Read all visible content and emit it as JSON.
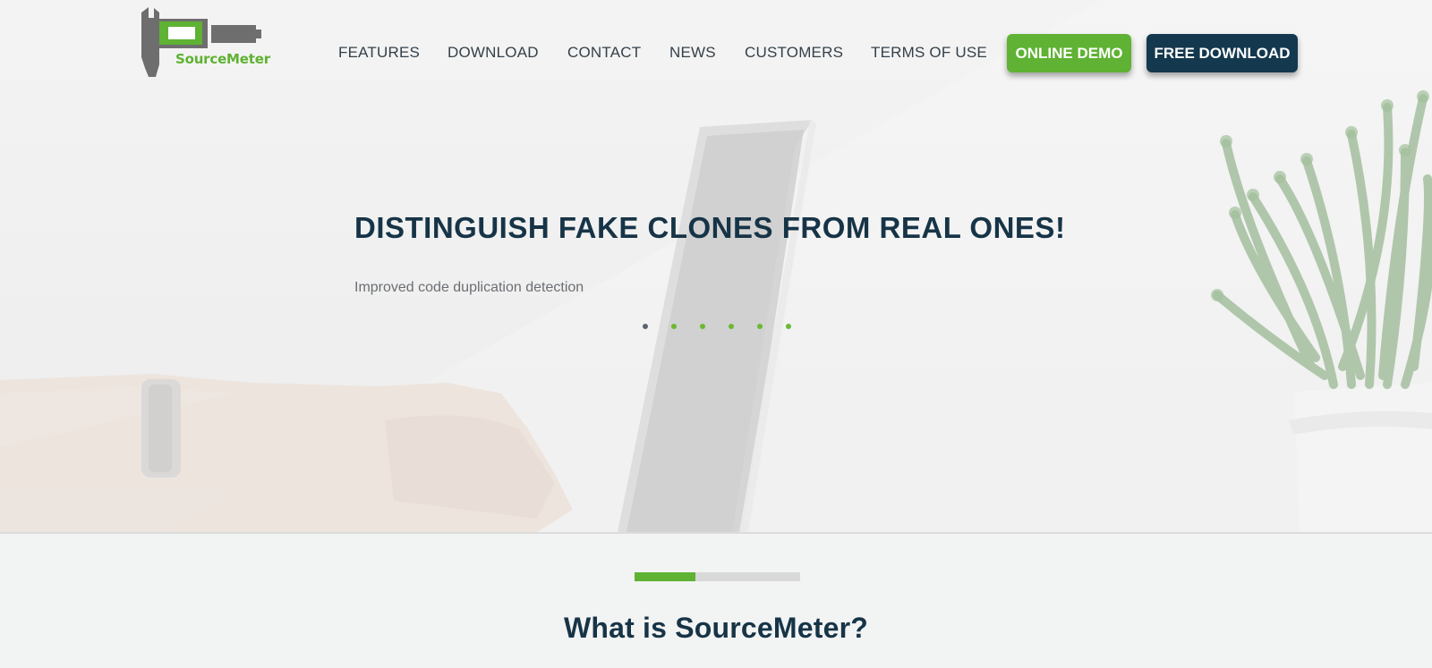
{
  "brand": {
    "name": "SourceMeter",
    "color_green": "#5fb233",
    "color_navy": "#14384d"
  },
  "nav": {
    "links": [
      "FEATURES",
      "DOWNLOAD",
      "CONTACT",
      "NEWS",
      "CUSTOMERS",
      "TERMS OF USE"
    ],
    "demo_label": "ONLINE DEMO",
    "download_label": "FREE DOWNLOAD"
  },
  "hero": {
    "headline": "DISTINGUISH FAKE CLONES FROM REAL ONES!",
    "subline": "Improved code duplication detection",
    "slides_count": 6,
    "active_slide": 1
  },
  "section": {
    "progress_fraction": 0.37,
    "title": "What is SourceMeter?"
  }
}
